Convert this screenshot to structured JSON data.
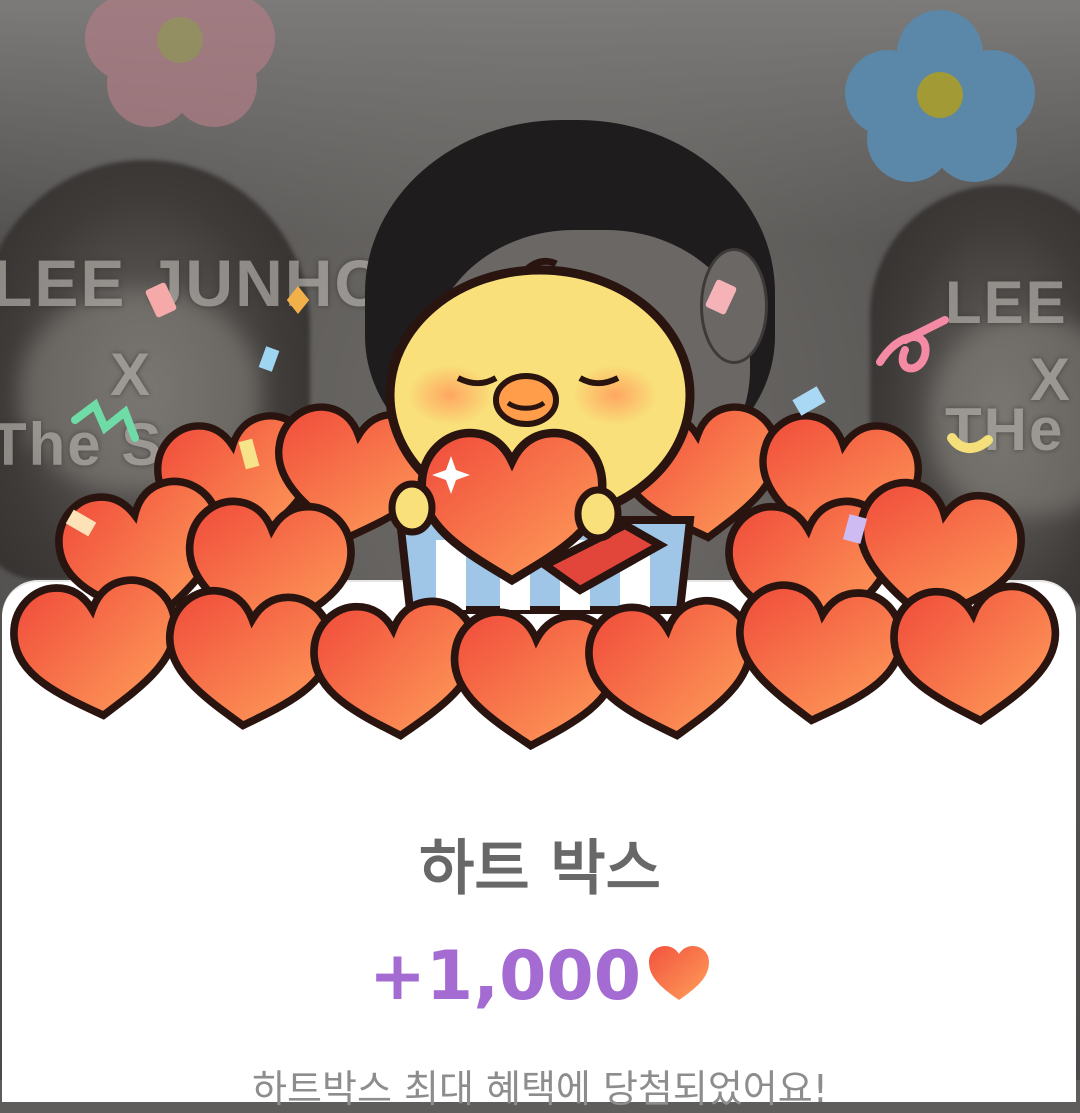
{
  "background": {
    "left_card_text": [
      "LEE JUNHO",
      "X",
      "The S"
    ],
    "right_card_text": [
      "LEE J",
      "X",
      "THe S"
    ]
  },
  "popup": {
    "title": "하트 박스",
    "reward_amount": "+1,000",
    "reward_icon": "heart-icon",
    "subtitle": "하트박스 최대 혜택에 당첨되었어요!"
  },
  "colors": {
    "reward_text": "#a46bd3",
    "title_text": "#686868",
    "heart_red": "#f2523f",
    "heart_orange": "#ff9855",
    "chick_yellow": "#f9e07a"
  }
}
